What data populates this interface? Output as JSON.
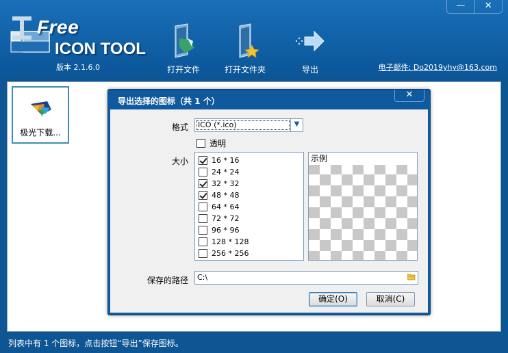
{
  "app": {
    "logo_line1": "Free",
    "logo_line2": "ICON TOOL",
    "version": "版本 2.1.6.0",
    "email": "电子邮件: Do2019yhy@163.com",
    "window_controls": {
      "minimize": "—",
      "close": "✕"
    }
  },
  "toolbar": {
    "open_file": "打开文件",
    "open_folder": "打开文件夹",
    "export": "导出"
  },
  "workspace": {
    "items": [
      {
        "label": "极光下载..."
      }
    ]
  },
  "status": "列表中有 1 个图标，点击按钮“导出”保存图标。",
  "dialog": {
    "title": "导出选择的图标（共 1 个）",
    "close": "✕",
    "format_label": "格式",
    "format_value": "ICO (*.ico)",
    "transparent_label": "透明",
    "transparent_checked": false,
    "size_label": "大小",
    "sizes": [
      {
        "label": "16 * 16",
        "checked": true
      },
      {
        "label": "24 * 24",
        "checked": false
      },
      {
        "label": "32 * 32",
        "checked": true
      },
      {
        "label": "48 * 48",
        "checked": true
      },
      {
        "label": "64 * 64",
        "checked": false
      },
      {
        "label": "72 * 72",
        "checked": false
      },
      {
        "label": "96 * 96",
        "checked": false
      },
      {
        "label": "128 * 128",
        "checked": false
      },
      {
        "label": "256 * 256",
        "checked": false
      }
    ],
    "preview_label": "示例",
    "path_label": "保存的路径",
    "path_value": "C:\\",
    "ok_button": "确定(O)",
    "cancel_button": "取消(C)"
  },
  "colors": {
    "window_blue": "#0e5594",
    "toolbar_blue": "#1162a8",
    "accent": "#3a8fb0"
  }
}
